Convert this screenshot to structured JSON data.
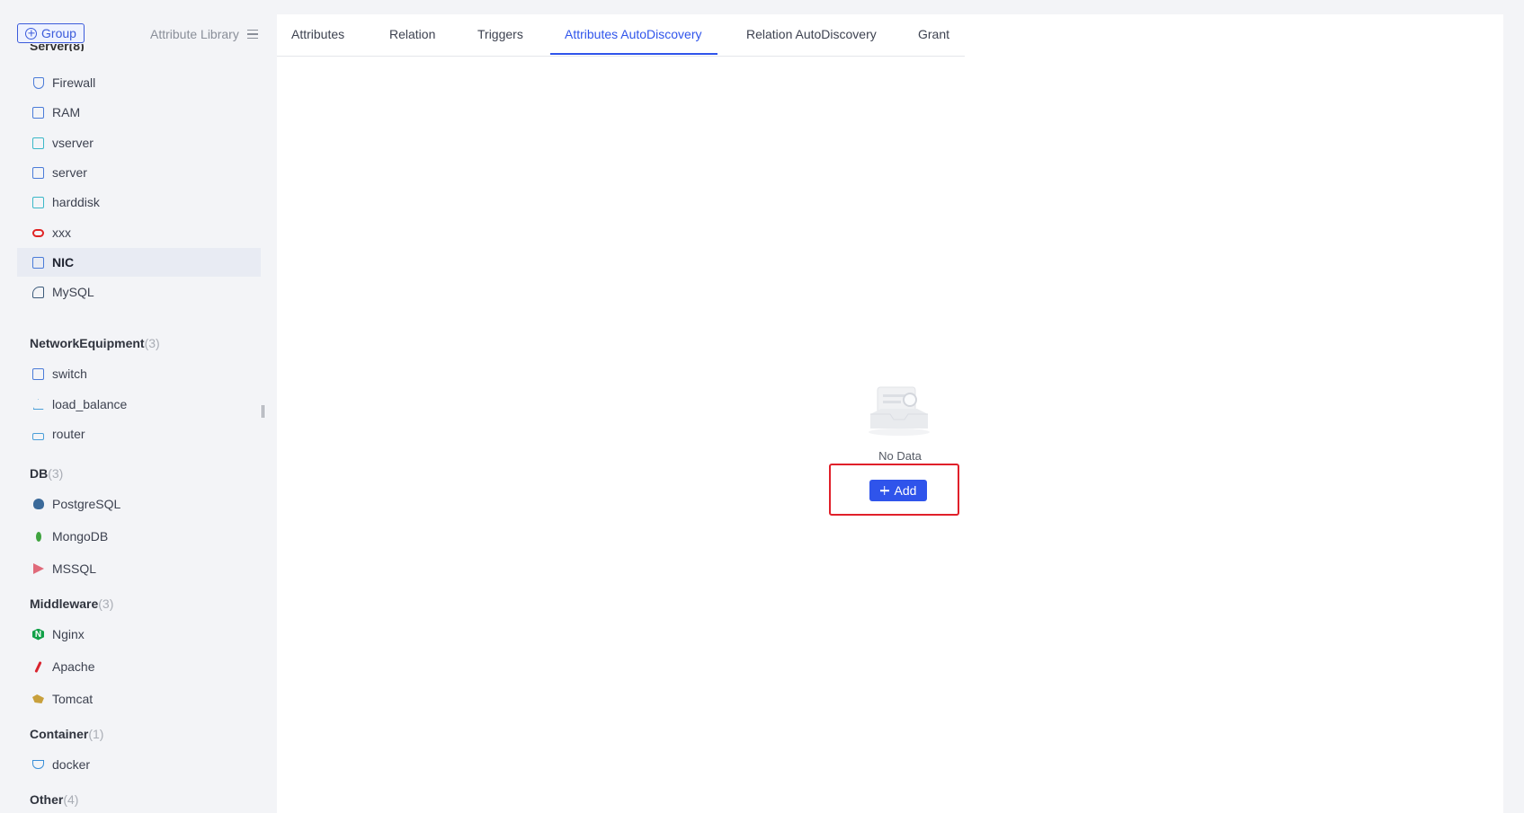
{
  "sidebar": {
    "group_button": "Group",
    "library_link": "Attribute Library",
    "cut_header": "Server(8)",
    "server_items": [
      "Firewall",
      "RAM",
      "vserver",
      "server",
      "harddisk",
      "xxx",
      "NIC",
      "MySQL"
    ],
    "network": {
      "name": "NetworkEquipment",
      "count": "(3)",
      "items": [
        "switch",
        "load_balance",
        "router"
      ]
    },
    "db": {
      "name": "DB",
      "count": "(3)",
      "items": [
        "PostgreSQL",
        "MongoDB",
        "MSSQL"
      ]
    },
    "middleware": {
      "name": "Middleware",
      "count": "(3)",
      "items": [
        "Nginx",
        "Apache",
        "Tomcat"
      ]
    },
    "container": {
      "name": "Container",
      "count": "(1)",
      "items": [
        "docker"
      ]
    },
    "other": {
      "name": "Other",
      "count": "(4)"
    },
    "active_item": "NIC"
  },
  "tabs": [
    "Attributes",
    "Relation",
    "Triggers",
    "Attributes AutoDiscovery",
    "Relation AutoDiscovery",
    "Grant"
  ],
  "active_tab": "Attributes AutoDiscovery",
  "empty": {
    "text": "No Data",
    "add_button": "Add"
  },
  "colors": {
    "primary": "#2f54eb",
    "highlight": "#e0202a",
    "active_bg": "#e8ebf3"
  }
}
